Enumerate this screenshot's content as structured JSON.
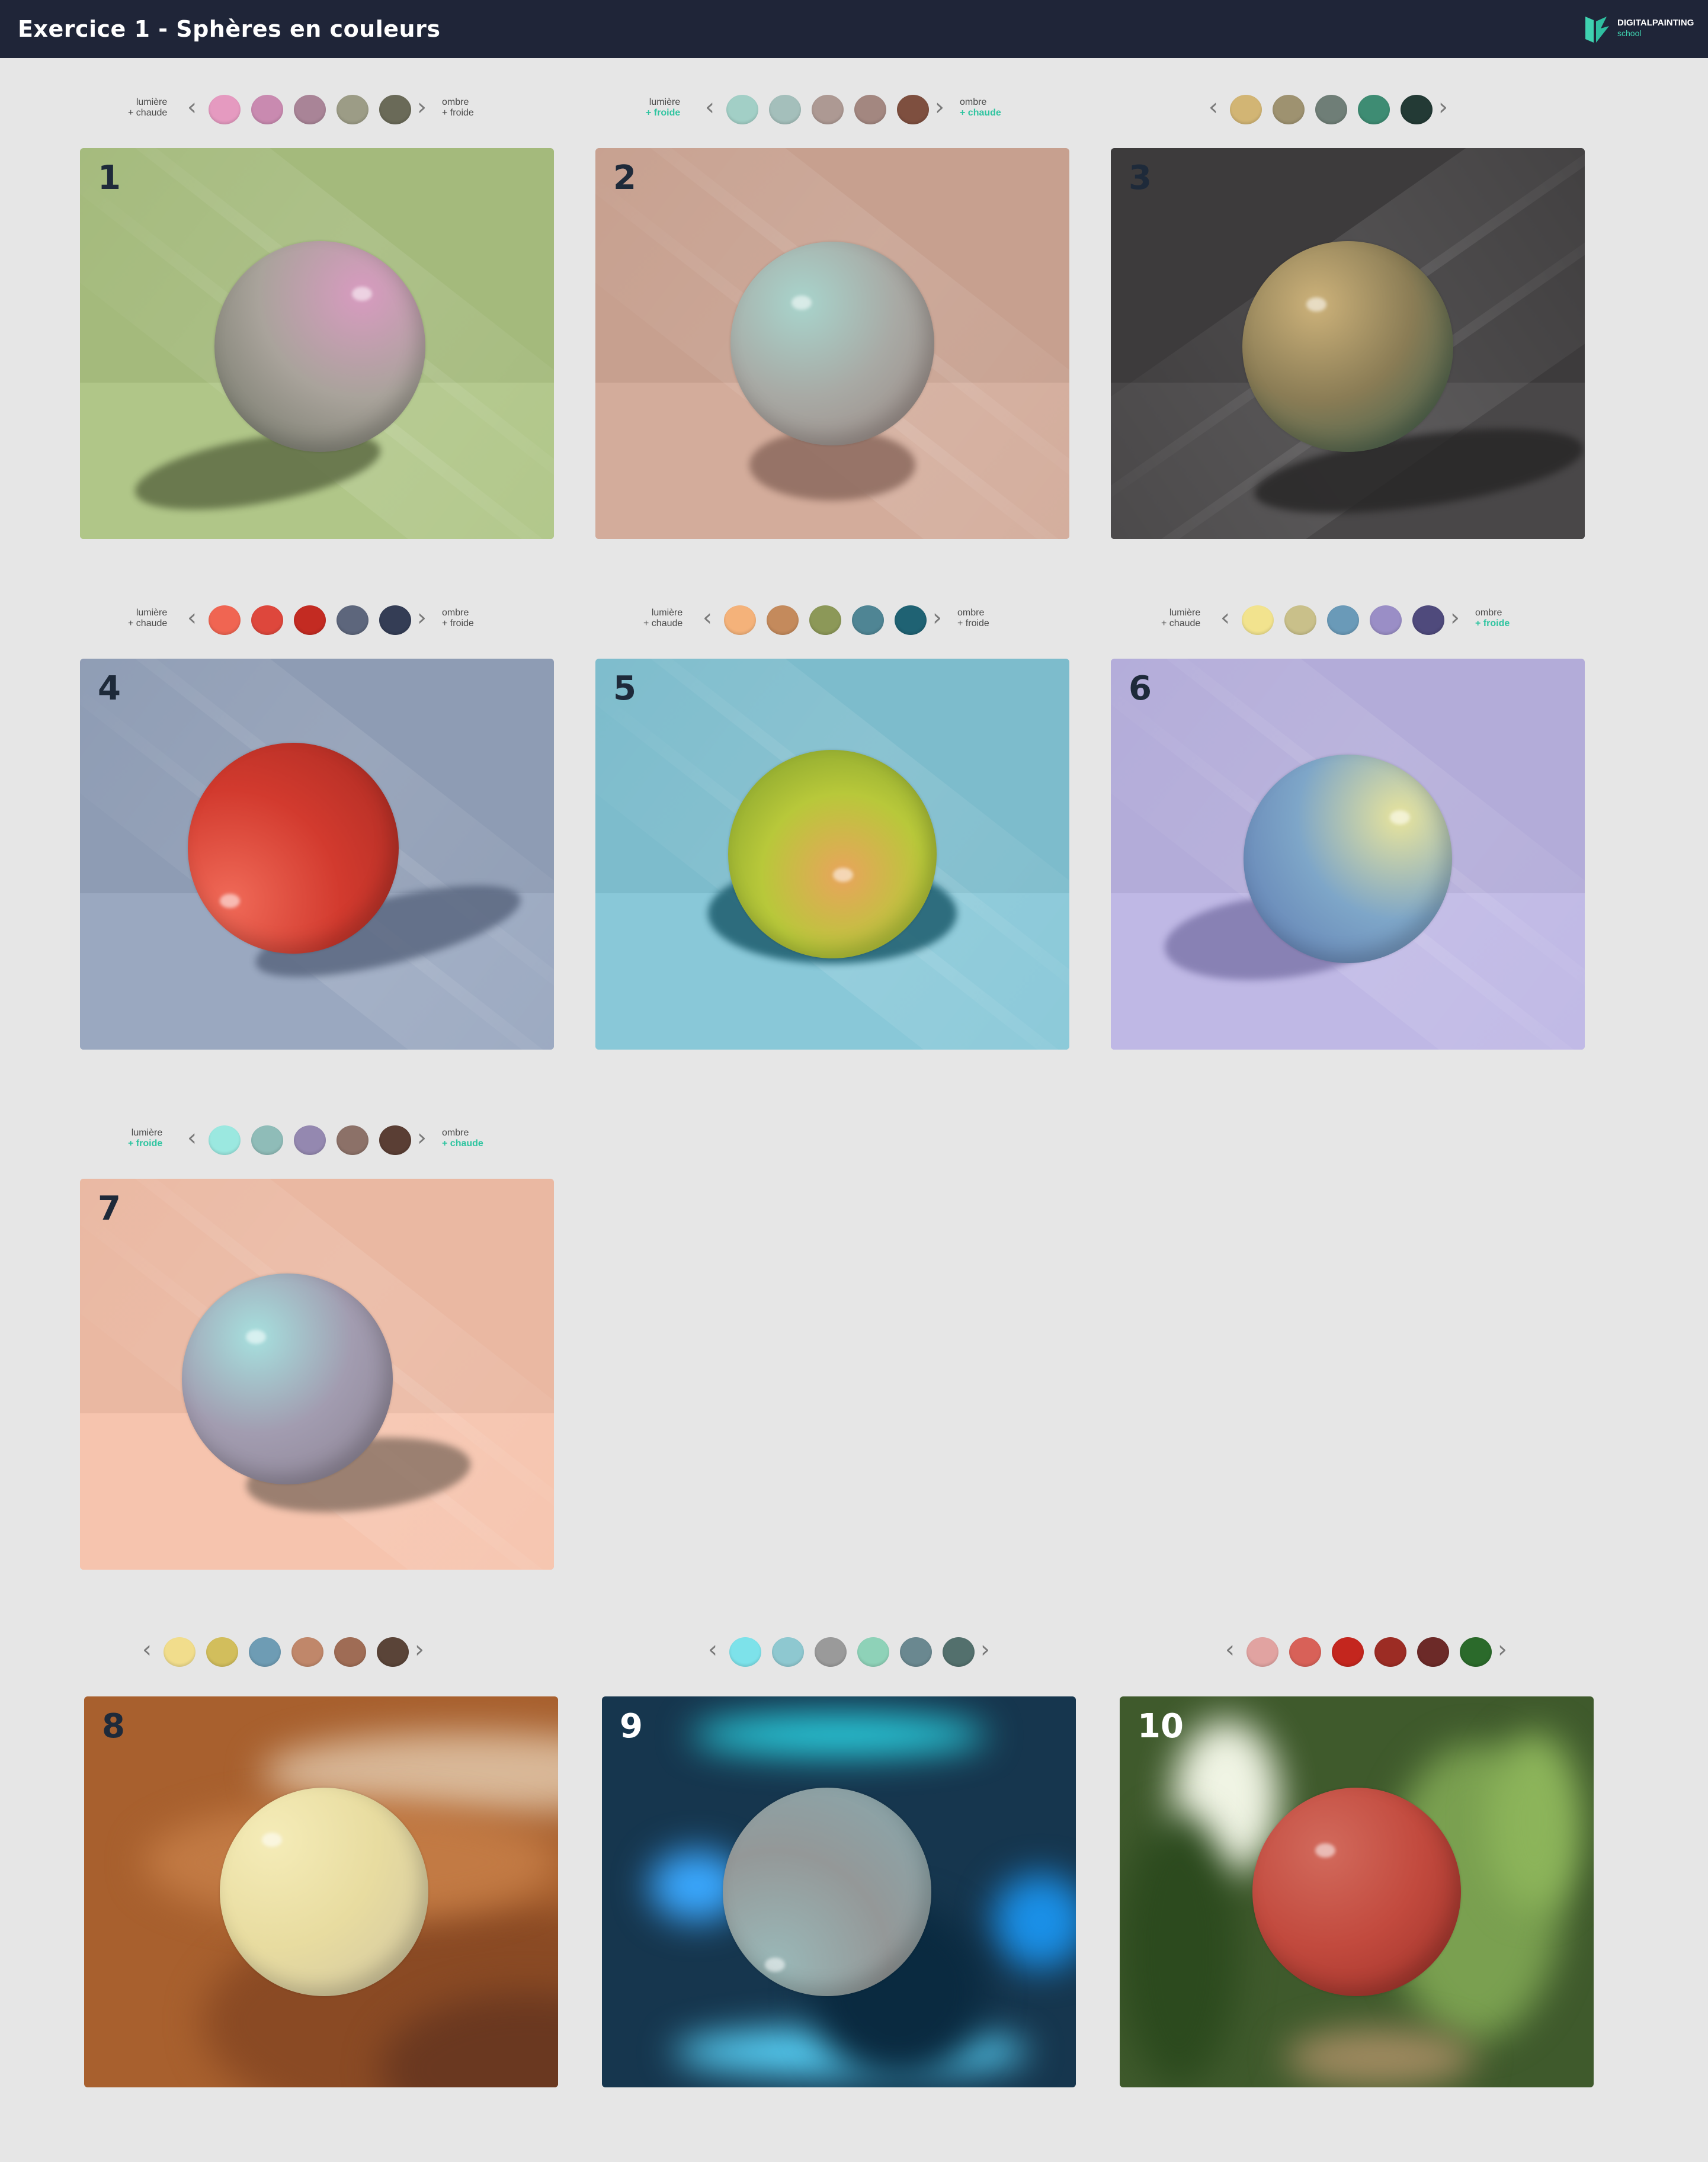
{
  "header": {
    "title": "Exercice 1 - Sphères en couleurs",
    "brand_line1": "DIGITALPAINTING",
    "brand_line2": "school"
  },
  "icons": {
    "logo": "brand-logo-icon",
    "prev": "chevron-left-icon",
    "next": "chevron-right-icon"
  },
  "palettes": [
    {
      "id": 1,
      "light_label": [
        "lumière",
        "+ chaude"
      ],
      "shadow_label": [
        "ombre",
        "+ froide"
      ],
      "colors": [
        "#e59ac0",
        "#c98ab0",
        "#a98497",
        "#9c9c86",
        "#6a6a58"
      ]
    },
    {
      "id": 2,
      "light_label": [
        "lumière",
        "+ froide"
      ],
      "shadow_label": [
        "ombre",
        "+ chaude"
      ],
      "colors": [
        "#a2cfc6",
        "#a4bfbb",
        "#ad9993",
        "#a38780",
        "#7e4f3f"
      ]
    },
    {
      "id": 3,
      "light_label": [],
      "shadow_label": [],
      "colors": [
        "#d2b574",
        "#9e9270",
        "#6f7e77",
        "#3e8c73",
        "#233a35"
      ]
    },
    {
      "id": 4,
      "light_label": [
        "lumière",
        "+ chaude"
      ],
      "shadow_label": [
        "ombre",
        "+ froide"
      ],
      "colors": [
        "#f06552",
        "#de473c",
        "#c32b22",
        "#5d667c",
        "#343d55"
      ]
    },
    {
      "id": 5,
      "light_label": [
        "lumière",
        "+ chaude"
      ],
      "shadow_label": [
        "ombre",
        "+ froide"
      ],
      "colors": [
        "#f4b27a",
        "#c48a5c",
        "#8c9858",
        "#4f8594",
        "#1f6273"
      ]
    },
    {
      "id": 6,
      "light_label": [
        "lumière",
        "+ chaude"
      ],
      "shadow_label": [
        "ombre",
        "+ froide"
      ],
      "colors": [
        "#f2e38e",
        "#c9c08a",
        "#6a9ab8",
        "#9a8ec6",
        "#4f4a7c"
      ]
    },
    {
      "id": 7,
      "light_label": [
        "lumière",
        "+ froide"
      ],
      "shadow_label": [
        "ombre",
        "+ chaude"
      ],
      "colors": [
        "#9be8e0",
        "#8fbcb8",
        "#9488b0",
        "#8c7168",
        "#5a3e34"
      ]
    },
    {
      "id": 8,
      "light_label": [],
      "shadow_label": [],
      "colors": [
        "#f1dd8c",
        "#d2be5c",
        "#6e9cb4",
        "#c0876a",
        "#9f6c55",
        "#5a4438"
      ]
    },
    {
      "id": 9,
      "light_label": [],
      "shadow_label": [],
      "colors": [
        "#7de2ea",
        "#8ec8d0",
        "#9a9a9a",
        "#8ed2b8",
        "#6a8890",
        "#53706d"
      ]
    },
    {
      "id": 10,
      "light_label": [],
      "shadow_label": [],
      "colors": [
        "#e1a3a1",
        "#d86158",
        "#c4261e",
        "#9c2c24",
        "#6c2a28",
        "#2b6a2b"
      ]
    }
  ],
  "panels": [
    {
      "id": 1,
      "number": "1",
      "bg": "#a4ba7c",
      "sphere": [
        "#d89bc0",
        "#a9a39b",
        "#6d7263"
      ],
      "shadow": "#5e6c44"
    },
    {
      "id": 2,
      "number": "2",
      "bg": "#c7a08f",
      "sphere": [
        "#a8d4cc",
        "#a8aaa5",
        "#9a8580"
      ],
      "shadow": "#8c6a5e"
    },
    {
      "id": 3,
      "number": "3",
      "bg": "#3d3b3c",
      "sphere": [
        "#cdb27a",
        "#8a7c55",
        "#2f5a4c"
      ],
      "shadow": "#282727"
    },
    {
      "id": 4,
      "number": "4",
      "bg": "#8e9cb4",
      "sphere": [
        "#f06a58",
        "#d23a2e",
        "#a82a22"
      ],
      "shadow": "#5a6780"
    },
    {
      "id": 5,
      "number": "5",
      "bg": "#7dbccc",
      "sphere": [
        "#e9a45c",
        "#b8c83a",
        "#7a9a2a"
      ],
      "shadow": "#1d5d6e"
    },
    {
      "id": 6,
      "number": "6",
      "bg": "#b3acd9",
      "sphere": [
        "#e8e49c",
        "#7ea6c8",
        "#5c78b0"
      ],
      "shadow": "#7f78ac"
    },
    {
      "id": 7,
      "number": "7",
      "bg": "#eab8a2",
      "sphere": [
        "#a6e0de",
        "#a29cb0",
        "#8a8090"
      ],
      "shadow": "#8c7466"
    },
    {
      "id": 8,
      "number": "8",
      "bg": "#a8602e",
      "sphere": [
        "#f5ecb8",
        "#e8dca0",
        "#cfc4a0"
      ],
      "shadow": ""
    },
    {
      "id": 9,
      "number": "9",
      "bg": "#16364e",
      "sphere": [
        "#9ab8b8",
        "#949898",
        "#88aab0"
      ],
      "shadow": ""
    },
    {
      "id": 10,
      "number": "10",
      "bg": "#3f5a2c",
      "sphere": [
        "#d26a5c",
        "#c24a3e",
        "#9a2e26"
      ],
      "shadow": ""
    }
  ]
}
